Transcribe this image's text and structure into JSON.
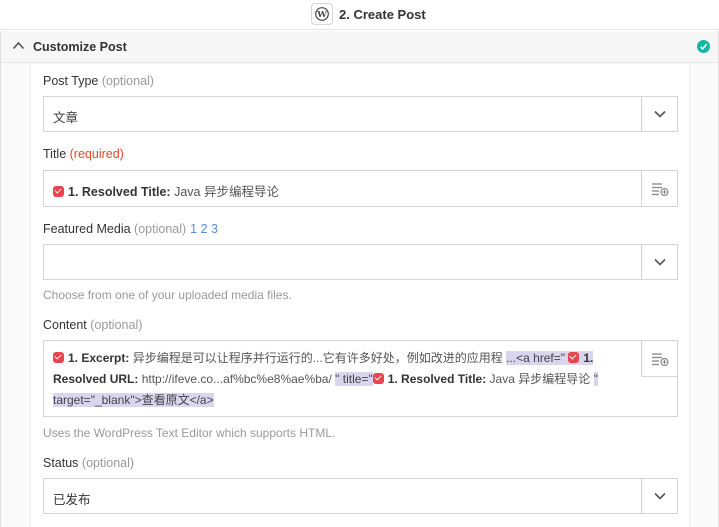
{
  "step": {
    "title": "2. Create Post",
    "app_icon": "wordpress-icon"
  },
  "section": {
    "title": "Customize Post",
    "status_icon": "check-circle-icon"
  },
  "fields": {
    "post_type": {
      "label": "Post Type",
      "hint": "(optional)",
      "value": "文章"
    },
    "title": {
      "label": "Title",
      "hint": "(required)",
      "token_label": "1. Resolved Title:",
      "token_value": "Java 异步编程导论"
    },
    "featured_media": {
      "label": "Featured Media",
      "hint": "(optional)",
      "pages": "1 2 3",
      "value": "",
      "help": "Choose from one of your uploaded media files."
    },
    "content": {
      "label": "Content",
      "hint": "(optional)",
      "tok1_label": "1. Excerpt:",
      "tok1_value": "异步编程是可以让程序并行运行的...它有许多好处，例如改进的应用程",
      "html1": "...<a href=\"",
      "tok2_label_a": "1.",
      "tok2_label_b": "Resolved URL:",
      "tok2_value": "http://ifeve.co...af%bc%e8%ae%ba/",
      "html2": "\" title=\"",
      "tok3_label": "1. Resolved Title:",
      "tok3_value": "Java 异步编程导论",
      "html3": "\"",
      "html4": "target=\"_blank\">查看原文</a>",
      "help": "Uses the WordPress Text Editor which supports HTML."
    },
    "status": {
      "label": "Status",
      "hint": "(optional)",
      "value": "已发布"
    }
  },
  "colors": {
    "accent_teal": "#13b5a5",
    "required_red": "#e8452c",
    "token_red": "#e8454d",
    "highlight": "#d9d5ee"
  }
}
